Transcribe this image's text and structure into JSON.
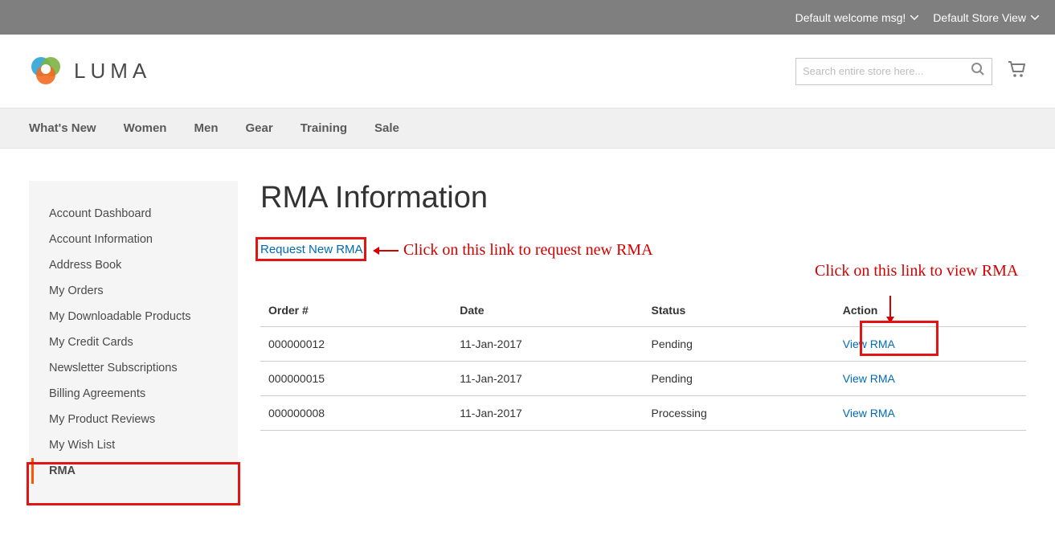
{
  "topbar": {
    "welcome": "Default welcome msg!",
    "store_view": "Default Store View"
  },
  "header": {
    "logo_text": "LUMA",
    "search_placeholder": "Search entire store here..."
  },
  "nav": [
    "What's New",
    "Women",
    "Men",
    "Gear",
    "Training",
    "Sale"
  ],
  "sidebar": {
    "items": [
      "Account Dashboard",
      "Account Information",
      "Address Book",
      "My Orders",
      "My Downloadable Products",
      "My Credit Cards",
      "Newsletter Subscriptions",
      "Billing Agreements",
      "My Product Reviews",
      "My Wish List",
      "RMA"
    ],
    "active_index": 10
  },
  "page": {
    "title": "RMA Information",
    "request_link": "Request New RMA"
  },
  "table": {
    "headers": [
      "Order #",
      "Date",
      "Status",
      "Action"
    ],
    "rows": [
      {
        "order": "000000012",
        "date": "11-Jan-2017",
        "status": "Pending",
        "action": "View RMA"
      },
      {
        "order": "000000015",
        "date": "11-Jan-2017",
        "status": "Pending",
        "action": "View RMA"
      },
      {
        "order": "000000008",
        "date": "11-Jan-2017",
        "status": "Processing",
        "action": "View RMA"
      }
    ]
  },
  "annotations": {
    "request_hint": "Click on this link to request new RMA",
    "view_hint": "Click on this link to view RMA"
  }
}
